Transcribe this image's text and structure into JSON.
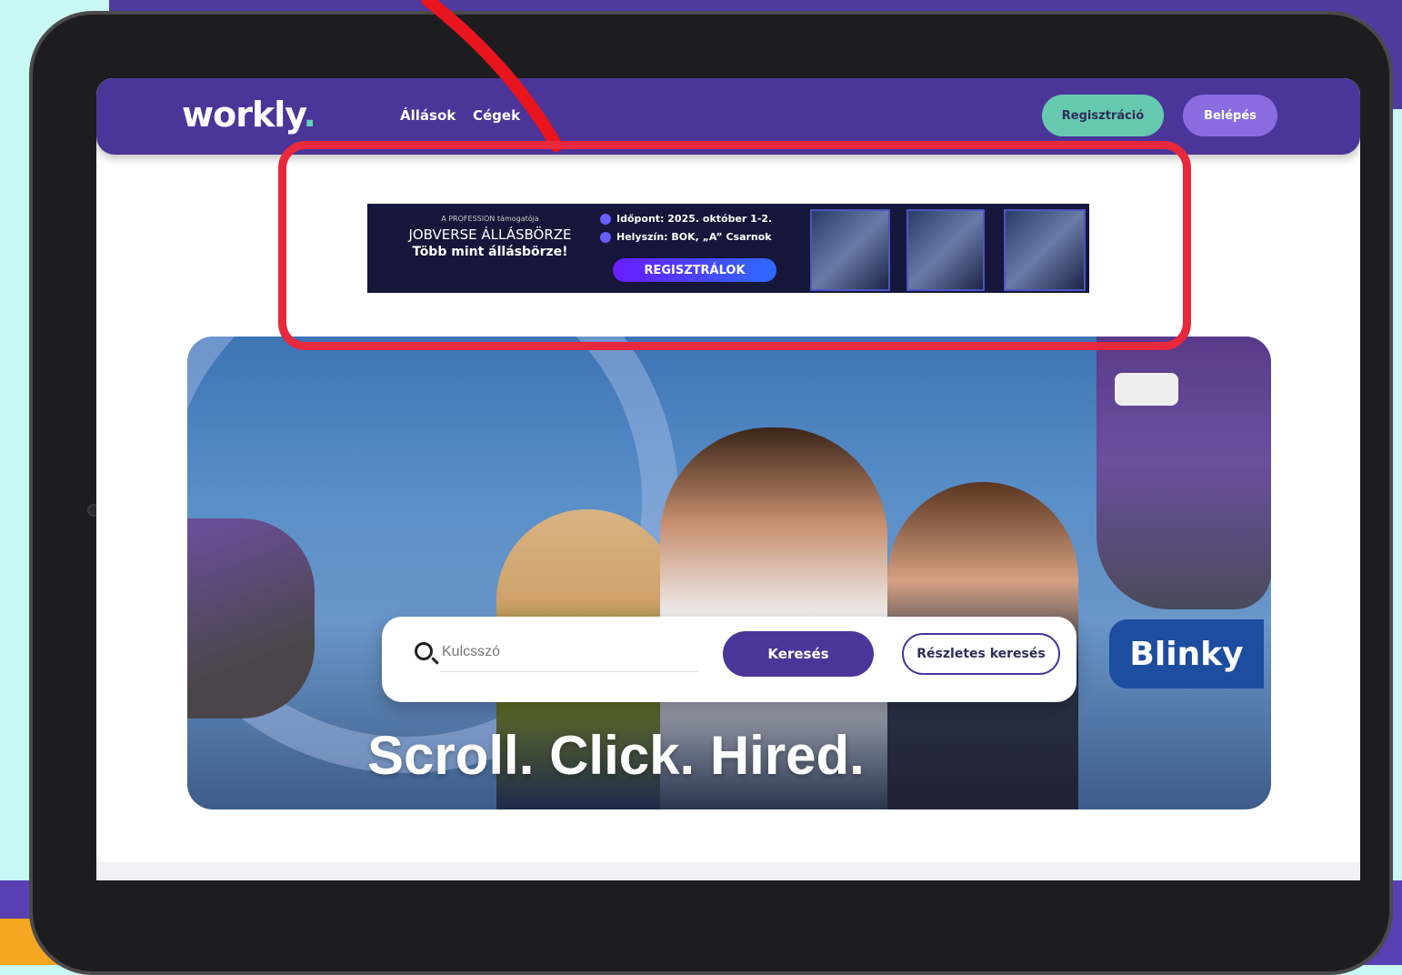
{
  "header": {
    "logo_text": "workly",
    "logo_dot": ".",
    "nav": [
      {
        "label": "Állások"
      },
      {
        "label": "Cégek"
      }
    ],
    "register_label": "Regisztráció",
    "login_label": "Belépés"
  },
  "banner": {
    "small_text": "A PROFESSION támogatója",
    "title": "JOBVERSE ÁLLÁSBÖRZE",
    "subtitle": "Több mint állásbörze!",
    "date_text": "Időpont: 2025. október 1-2.",
    "location_text": "Helyszín: BOK, „A” Csarnok",
    "cta_label": "REGISZTRÁLOK"
  },
  "hero": {
    "title": "Scroll. Click. Hired.",
    "brand_sign": "Blinky"
  },
  "search": {
    "placeholder": "Kulcsszó",
    "search_label": "Keresés",
    "advanced_label": "Részletes keresés"
  },
  "colors": {
    "navbar": "#4b3598",
    "register_button": "#67c9b0",
    "login_button": "#8b6ce0",
    "highlight": "#e8283c"
  }
}
